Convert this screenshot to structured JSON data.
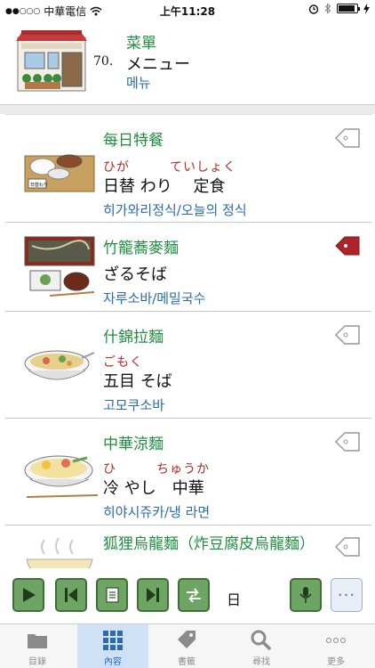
{
  "status_bar": {
    "signal_dots": "●●○○○",
    "carrier": "中華電信",
    "wifi_icon": "wifi-icon",
    "time": "上午11:28",
    "alarm_icon": "alarm-icon",
    "bluetooth_icon": "bluetooth-icon",
    "battery_level": 0.9
  },
  "header": {
    "number": "70.",
    "chinese": "菜單",
    "japanese": "メニュー",
    "korean": "메뉴",
    "icon": "restaurant-icon"
  },
  "items": [
    {
      "chinese": "每日特餐",
      "ruby": "ひが　　　ていしょく",
      "japanese": "日替 わり　 定食",
      "korean": "히가와리정식/오늘의 정식",
      "bookmarked": false,
      "image": "set-meal-icon"
    },
    {
      "chinese": "竹籠蕎麥麵",
      "ruby": "",
      "japanese": "ざるそば",
      "korean": "자루소바/메밀국수",
      "bookmarked": true,
      "image": "zaru-soba-icon"
    },
    {
      "chinese": "什錦拉麵",
      "ruby": "ごもく",
      "japanese": "五目 そば",
      "korean": "고모쿠소바",
      "bookmarked": false,
      "image": "gomoku-soba-icon"
    },
    {
      "chinese": "中華涼麵",
      "ruby": "ひ　　　ちゅうか",
      "japanese": "冷 やし　中華",
      "korean": "히야시쥬카/냉 라면",
      "bookmarked": false,
      "image": "cold-ramen-icon"
    },
    {
      "chinese": "狐狸烏龍麵（炸豆腐皮烏龍麵）",
      "ruby": "",
      "japanese": "",
      "korean": "",
      "bookmarked": false,
      "image": "kitsune-udon-icon"
    }
  ],
  "toolbar": {
    "day_label": "日",
    "buttons": [
      "play-icon",
      "previous-icon",
      "list-icon",
      "next-icon",
      "swap-icon",
      "microphone-icon",
      "more-icon"
    ],
    "more_label": "···"
  },
  "tabs": [
    {
      "label": "目錄",
      "icon": "folder-icon",
      "active": false
    },
    {
      "label": "內容",
      "icon": "grid-icon",
      "active": true
    },
    {
      "label": "書籤",
      "icon": "tag-icon",
      "active": false
    },
    {
      "label": "尋找",
      "icon": "search-icon",
      "active": false
    },
    {
      "label": "更多",
      "icon": "more-icon",
      "active": false
    }
  ],
  "colors": {
    "chinese_text": "#1e8e3e",
    "korean_text": "#2b6cb0",
    "ruby_text": "#b52a2a",
    "toolbar_button": "#6ea564",
    "bookmark_active": "#b0232a"
  }
}
